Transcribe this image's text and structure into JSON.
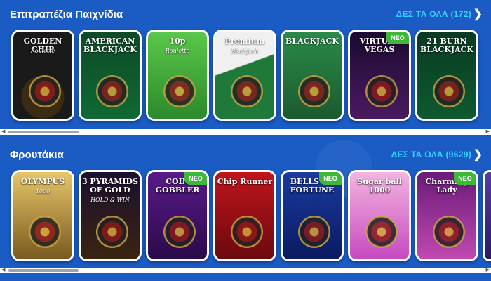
{
  "sections": [
    {
      "title": "Επιτραπέζια Παιχνίδια",
      "see_all": "ΔΕΣ ΤΑ ΟΛΑ (172)",
      "cards": [
        {
          "name": "golden-chip-roulette",
          "label": "GOLDEN CHIP",
          "sub": "Roulette",
          "theme": "t-gold",
          "badge": ""
        },
        {
          "name": "american-blackjack",
          "label": "AMERICAN BLACKJACK",
          "sub": "",
          "theme": "t-green",
          "badge": ""
        },
        {
          "name": "10p-roulette",
          "label": "10p",
          "sub": "Roulette",
          "theme": "t-roulette",
          "badge": ""
        },
        {
          "name": "premium-blackjack",
          "label": "Premium",
          "sub": "Blackjack",
          "theme": "t-table",
          "badge": ""
        },
        {
          "name": "blackjack",
          "label": "BLACKJACK",
          "sub": "",
          "theme": "t-bjblue",
          "badge": ""
        },
        {
          "name": "virtual-vegas-roulette",
          "label": "VIRTUAL VEGAS",
          "sub": "",
          "theme": "t-vegas",
          "badge": "NEO"
        },
        {
          "name": "21-burn-blackjack",
          "label": "21 BURN BLACKJACK",
          "sub": "",
          "theme": "t-21",
          "badge": ""
        }
      ]
    },
    {
      "title": "Φρουτάκια",
      "see_all": "ΔΕΣ ΤΑ ΟΛΑ (9629)",
      "cards": [
        {
          "name": "drops-wins-olympus",
          "label": "OLYMPUS",
          "sub": "1000",
          "theme": "t-zeus",
          "badge": ""
        },
        {
          "name": "3-pyramids-of-gold",
          "label": "3 PYRAMIDS OF GOLD",
          "sub": "HOLD & WIN",
          "theme": "t-pharaoh",
          "badge": ""
        },
        {
          "name": "coin-gobbler",
          "label": "COIN GOBBLER",
          "sub": "",
          "theme": "t-gobbler",
          "badge": "NEO"
        },
        {
          "name": "chip-runner",
          "label": "Chip Runner",
          "sub": "",
          "theme": "t-chip",
          "badge": ""
        },
        {
          "name": "bells-of-fortune",
          "label": "BELLS OF FORTUNE",
          "sub": "",
          "theme": "t-bells",
          "badge": "NEO"
        },
        {
          "name": "sugar-ball-1000",
          "label": "Sugar ball 1000",
          "sub": "",
          "theme": "t-sugar",
          "badge": ""
        },
        {
          "name": "charming-lady",
          "label": "Charming Lady",
          "sub": "",
          "theme": "t-charm",
          "badge": "NEO"
        },
        {
          "name": "partial-card",
          "label": "",
          "sub": "",
          "theme": "t-partial",
          "badge": ""
        }
      ]
    }
  ],
  "colors": {
    "background": "#1a5bc4",
    "see_all_link": "#35d2ff",
    "new_badge": "#3fb83a",
    "card_border": "#ffffff"
  },
  "icons": {
    "see_all_arrow": "chevron-right-icon",
    "scroll_left": "scroll-left-arrow-icon",
    "scroll_right": "scroll-right-arrow-icon"
  }
}
